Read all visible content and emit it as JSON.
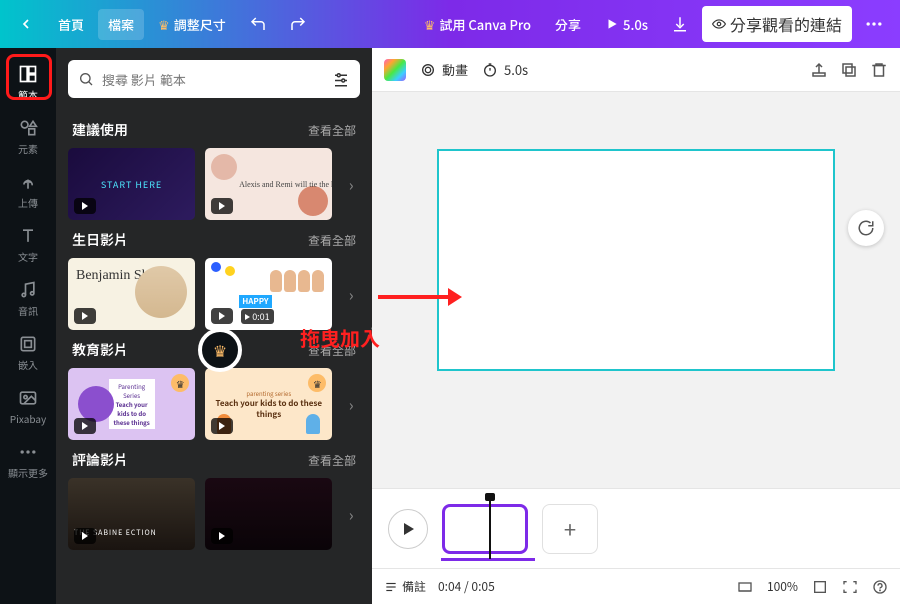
{
  "topbar": {
    "home": "首頁",
    "file": "檔案",
    "resize": "調整尺寸",
    "tryPro": "試用 Canva Pro",
    "share": "分享",
    "playDuration": "5.0s",
    "shareViewLink": "分享觀看的連結"
  },
  "sidebar": {
    "templates": "範本",
    "elements": "元素",
    "uploads": "上傳",
    "text": "文字",
    "audio": "音訊",
    "embeds": "嵌入",
    "pixabay": "Pixabay",
    "more": "顯示更多"
  },
  "search": {
    "placeholder": "搜尋 影片 範本"
  },
  "sections": {
    "recommended": {
      "title": "建議使用",
      "seeall": "查看全部"
    },
    "birthday": {
      "title": "生日影片",
      "seeall": "查看全部"
    },
    "education": {
      "title": "教育影片",
      "seeall": "查看全部"
    },
    "review": {
      "title": "評論影片",
      "seeall": "查看全部"
    }
  },
  "cards": {
    "startHere": "START HERE",
    "alexis": "Alexis and Remi will tie the knot!",
    "benjamin": "Benjamin Shah",
    "happy": "HAPPY",
    "cardTime": "0:01",
    "parenting1_tag": "Parenting Series",
    "parenting1": "Teach your kids to do these things",
    "parenting2_tag": "parenting series",
    "parenting2": "Teach your kids to do these things",
    "sabine": "THE SABINE ECTION"
  },
  "editorToolbar": {
    "animation": "動畫",
    "duration": "5.0s"
  },
  "annotation": {
    "dragToAdd": "拖曳加入"
  },
  "bottombar": {
    "notes": "備註",
    "time": "0:04 / 0:05",
    "zoom": "100%"
  }
}
